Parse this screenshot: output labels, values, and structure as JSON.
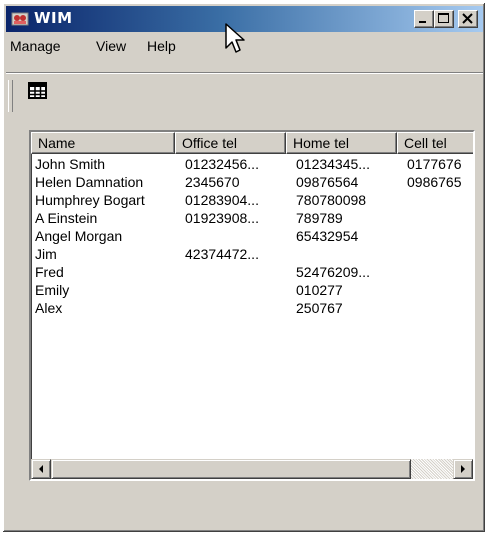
{
  "window": {
    "title": "WIM",
    "controls": {
      "minimize_icon": "minimize-icon",
      "maximize_icon": "maximize-icon",
      "close_icon": "close-icon"
    }
  },
  "menu": {
    "items": [
      {
        "label": "Manage"
      },
      {
        "label": "View"
      },
      {
        "label": "Help"
      }
    ]
  },
  "toolbar": {
    "grid_view_icon": "grid-view-icon"
  },
  "list": {
    "columns": [
      {
        "label": "Name"
      },
      {
        "label": "Office tel"
      },
      {
        "label": "Home tel"
      },
      {
        "label": "Cell tel"
      }
    ],
    "rows": [
      {
        "name": "John Smith",
        "office": "01232456...",
        "home": "01234345...",
        "cell": "0177676"
      },
      {
        "name": "Helen Damnation",
        "office": "2345670",
        "home": "09876564",
        "cell": "0986765"
      },
      {
        "name": "Humphrey Bogart",
        "office": "01283904...",
        "home": "780780098",
        "cell": ""
      },
      {
        "name": "A Einstein",
        "office": "01923908...",
        "home": "789789",
        "cell": ""
      },
      {
        "name": "Angel Morgan",
        "office": "",
        "home": "65432954",
        "cell": ""
      },
      {
        "name": "Jim",
        "office": "42374472...",
        "home": "",
        "cell": ""
      },
      {
        "name": "Fred",
        "office": "",
        "home": "52476209...",
        "cell": ""
      },
      {
        "name": "Emily",
        "office": "",
        "home": "010277",
        "cell": ""
      },
      {
        "name": "Alex",
        "office": "",
        "home": "250767",
        "cell": ""
      }
    ]
  },
  "colors": {
    "titlebar_start": "#0a246a",
    "titlebar_end": "#a6caf0",
    "face": "#d4d0c8"
  }
}
